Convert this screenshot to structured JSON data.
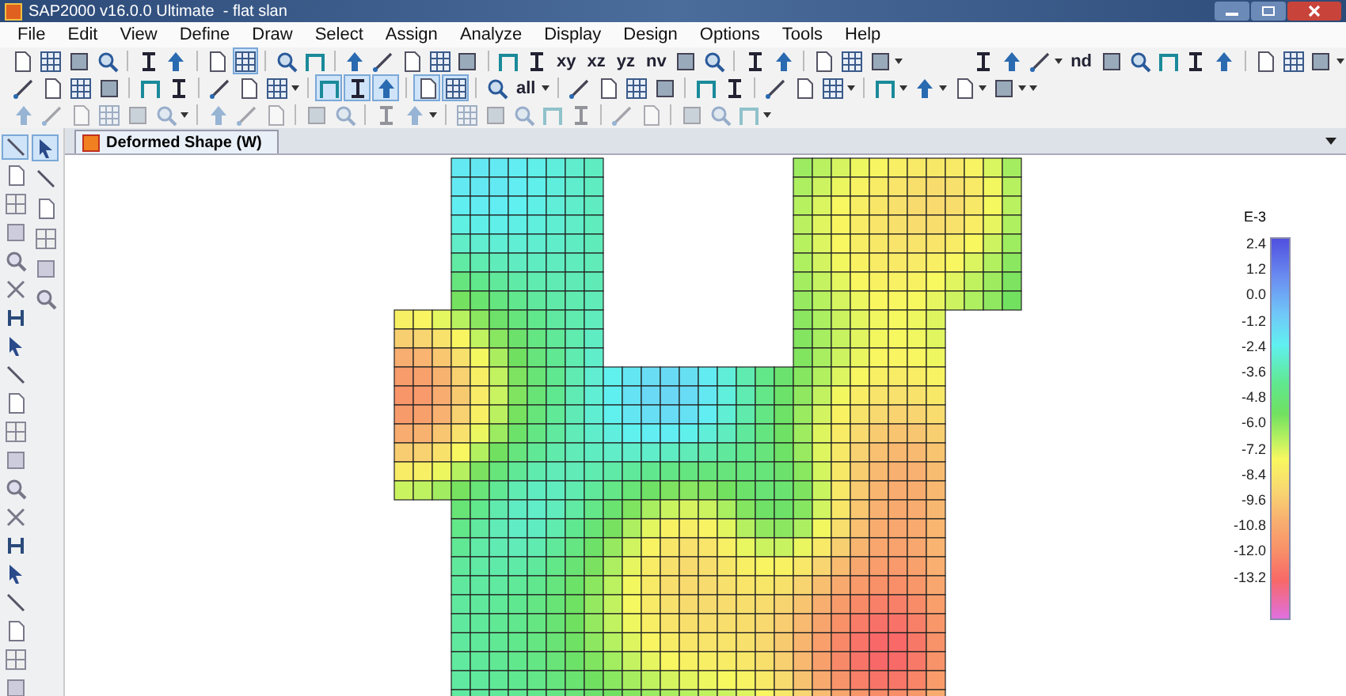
{
  "window": {
    "title": "SAP2000 v16.0.0 Ultimate  - flat slan"
  },
  "menu": [
    "File",
    "Edit",
    "View",
    "Define",
    "Draw",
    "Select",
    "Assign",
    "Analyze",
    "Display",
    "Design",
    "Options",
    "Tools",
    "Help"
  ],
  "toolbars": [
    {
      "disabled": false,
      "items": [
        {
          "kind": "icon",
          "selected": false
        },
        {
          "kind": "icon",
          "selected": false
        },
        {
          "kind": "icon",
          "selected": false
        },
        {
          "kind": "icon",
          "selected": false
        },
        {
          "kind": "sep"
        },
        {
          "kind": "icon",
          "selected": false
        },
        {
          "kind": "icon",
          "selected": false
        },
        {
          "kind": "sep"
        },
        {
          "kind": "icon",
          "selected": false
        },
        {
          "kind": "icon",
          "selected": true
        },
        {
          "kind": "sep"
        },
        {
          "kind": "icon",
          "selected": false
        },
        {
          "kind": "icon",
          "selected": false
        },
        {
          "kind": "sep"
        },
        {
          "kind": "icon",
          "selected": false
        },
        {
          "kind": "icon",
          "selected": false
        },
        {
          "kind": "icon",
          "selected": false
        },
        {
          "kind": "icon",
          "selected": false
        },
        {
          "kind": "icon",
          "selected": false
        },
        {
          "kind": "sep"
        },
        {
          "kind": "icon",
          "selected": false
        },
        {
          "kind": "icon",
          "selected": false
        },
        {
          "kind": "text",
          "label": "xy",
          "selected": false
        },
        {
          "kind": "text",
          "label": "xz",
          "selected": false
        },
        {
          "kind": "text",
          "label": "yz",
          "selected": false
        },
        {
          "kind": "text",
          "label": "nv",
          "selected": false
        },
        {
          "kind": "icon",
          "selected": false
        },
        {
          "kind": "icon",
          "selected": false
        },
        {
          "kind": "sep"
        },
        {
          "kind": "icon",
          "selected": false
        },
        {
          "kind": "icon",
          "selected": false
        },
        {
          "kind": "sep"
        },
        {
          "kind": "icon",
          "selected": false
        },
        {
          "kind": "icon",
          "selected": false
        },
        {
          "kind": "icon",
          "selected": false
        },
        {
          "kind": "caret"
        },
        {
          "kind": "gap"
        },
        {
          "kind": "icon",
          "selected": false
        },
        {
          "kind": "icon",
          "selected": false
        },
        {
          "kind": "icon",
          "selected": false
        },
        {
          "kind": "caret"
        },
        {
          "kind": "text",
          "label": "nd",
          "selected": false
        },
        {
          "kind": "icon",
          "selected": false
        },
        {
          "kind": "icon",
          "selected": false
        },
        {
          "kind": "icon",
          "selected": false
        },
        {
          "kind": "icon",
          "selected": false
        },
        {
          "kind": "icon",
          "selected": false
        },
        {
          "kind": "sep"
        },
        {
          "kind": "icon",
          "selected": false
        },
        {
          "kind": "icon",
          "selected": false
        },
        {
          "kind": "icon",
          "selected": false
        },
        {
          "kind": "caret"
        }
      ]
    },
    {
      "disabled": false,
      "items": [
        {
          "kind": "icon",
          "selected": false
        },
        {
          "kind": "icon",
          "selected": false
        },
        {
          "kind": "icon",
          "selected": false
        },
        {
          "kind": "icon",
          "selected": false
        },
        {
          "kind": "sep"
        },
        {
          "kind": "icon",
          "selected": false
        },
        {
          "kind": "icon",
          "selected": false
        },
        {
          "kind": "sep"
        },
        {
          "kind": "icon",
          "selected": false
        },
        {
          "kind": "icon",
          "selected": false
        },
        {
          "kind": "icon",
          "selected": false
        },
        {
          "kind": "caret"
        },
        {
          "kind": "sep"
        },
        {
          "kind": "icon",
          "selected": true
        },
        {
          "kind": "icon",
          "selected": true
        },
        {
          "kind": "icon",
          "selected": true
        },
        {
          "kind": "sep"
        },
        {
          "kind": "icon",
          "selected": true
        },
        {
          "kind": "icon",
          "selected": true
        },
        {
          "kind": "sep"
        },
        {
          "kind": "icon",
          "selected": false
        },
        {
          "kind": "text",
          "label": "all",
          "selected": false
        },
        {
          "kind": "caret"
        },
        {
          "kind": "sep"
        },
        {
          "kind": "icon",
          "selected": false
        },
        {
          "kind": "icon",
          "selected": false
        },
        {
          "kind": "icon",
          "selected": false
        },
        {
          "kind": "icon",
          "selected": false
        },
        {
          "kind": "sep"
        },
        {
          "kind": "icon",
          "selected": false
        },
        {
          "kind": "icon",
          "selected": false
        },
        {
          "kind": "sep"
        },
        {
          "kind": "icon",
          "selected": false
        },
        {
          "kind": "icon",
          "selected": false
        },
        {
          "kind": "icon",
          "selected": false
        },
        {
          "kind": "caret"
        },
        {
          "kind": "sep"
        },
        {
          "kind": "icon",
          "selected": false
        },
        {
          "kind": "caret"
        },
        {
          "kind": "icon",
          "selected": false
        },
        {
          "kind": "caret"
        },
        {
          "kind": "icon",
          "selected": false
        },
        {
          "kind": "caret"
        },
        {
          "kind": "icon",
          "selected": false
        },
        {
          "kind": "caret"
        },
        {
          "kind": "caret"
        }
      ]
    },
    {
      "disabled": true,
      "items": [
        {
          "kind": "icon",
          "selected": false
        },
        {
          "kind": "icon",
          "selected": false
        },
        {
          "kind": "icon",
          "selected": false
        },
        {
          "kind": "icon",
          "selected": false
        },
        {
          "kind": "icon",
          "selected": false
        },
        {
          "kind": "icon",
          "selected": false
        },
        {
          "kind": "caret"
        },
        {
          "kind": "sep"
        },
        {
          "kind": "icon",
          "selected": false
        },
        {
          "kind": "icon",
          "selected": false
        },
        {
          "kind": "icon",
          "selected": false
        },
        {
          "kind": "sep"
        },
        {
          "kind": "icon",
          "selected": false
        },
        {
          "kind": "icon",
          "selected": false
        },
        {
          "kind": "sep"
        },
        {
          "kind": "icon",
          "selected": false
        },
        {
          "kind": "icon",
          "selected": false
        },
        {
          "kind": "caret"
        },
        {
          "kind": "sep"
        },
        {
          "kind": "icon",
          "selected": false
        },
        {
          "kind": "icon",
          "selected": false
        },
        {
          "kind": "icon",
          "selected": false
        },
        {
          "kind": "icon",
          "selected": false
        },
        {
          "kind": "icon",
          "selected": false
        },
        {
          "kind": "sep"
        },
        {
          "kind": "icon",
          "selected": false
        },
        {
          "kind": "icon",
          "selected": false
        },
        {
          "kind": "sep"
        },
        {
          "kind": "icon",
          "selected": false
        },
        {
          "kind": "icon",
          "selected": false
        },
        {
          "kind": "icon",
          "selected": false
        },
        {
          "kind": "caret"
        }
      ]
    }
  ],
  "left_toolbar": [
    [
      {
        "selected": true
      },
      {
        "selected": false
      },
      {
        "selected": false
      },
      {
        "selected": false
      },
      {
        "selected": false
      },
      {
        "selected": false
      },
      {
        "selected": false
      },
      {
        "selected": false
      },
      {
        "selected": false
      },
      {
        "selected": false
      },
      {
        "selected": false
      },
      {
        "selected": false
      },
      {
        "selected": false
      },
      {
        "selected": false
      },
      {
        "selected": false
      },
      {
        "selected": false
      },
      {
        "selected": false
      },
      {
        "selected": false
      },
      {
        "selected": false
      },
      {
        "selected": false
      }
    ],
    [
      {
        "selected": true
      },
      {
        "selected": false
      },
      {
        "selected": false
      },
      {
        "selected": false
      },
      {
        "selected": false
      },
      {
        "selected": false
      }
    ]
  ],
  "tabs": [
    {
      "label": "Deformed Shape (W)",
      "selected": true
    }
  ],
  "legend": {
    "exponent": "E-3",
    "labels": [
      "2.4",
      "1.2",
      "0.0",
      "-1.2",
      "-2.4",
      "-3.6",
      "-4.8",
      "-6.0",
      "-7.2",
      "-8.4",
      "-9.6",
      "-10.8",
      "-12.0",
      "-13.2"
    ]
  }
}
